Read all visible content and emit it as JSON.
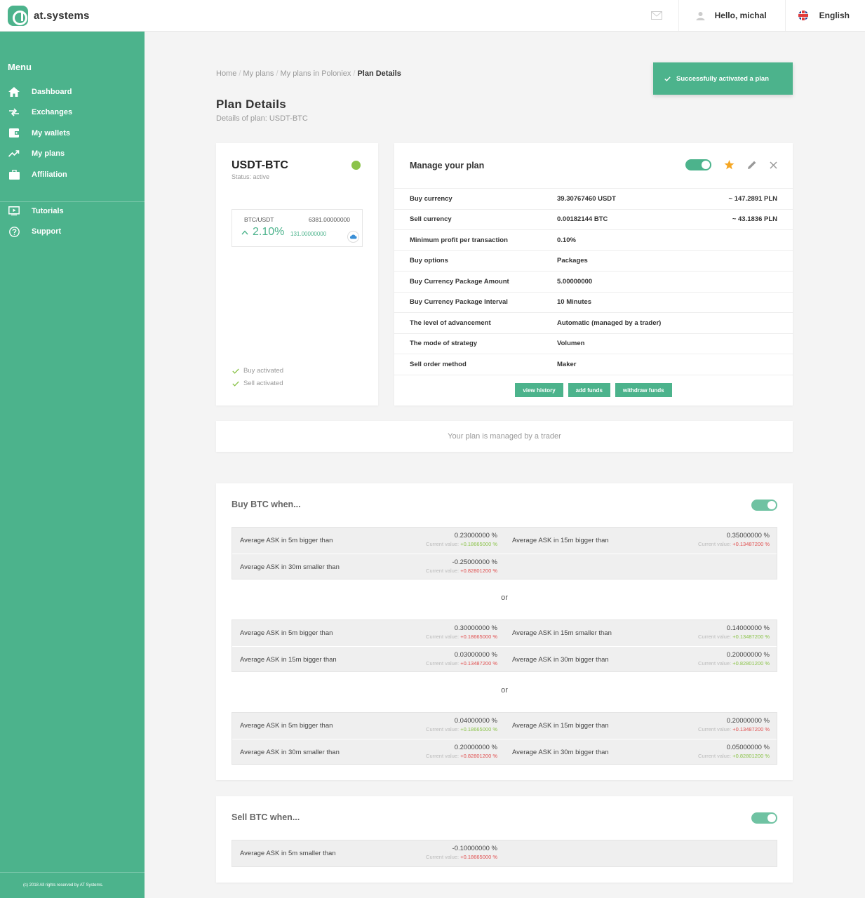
{
  "header": {
    "brand": "at.systems",
    "greeting": "Hello, michal",
    "language": "English"
  },
  "sidebar": {
    "menu_title": "Menu",
    "items": [
      {
        "label": "Dashboard",
        "icon": "home-icon"
      },
      {
        "label": "Exchanges",
        "icon": "exchange-icon"
      },
      {
        "label": "My wallets",
        "icon": "wallet-icon"
      },
      {
        "label": "My plans",
        "icon": "trend-icon"
      },
      {
        "label": "Affiliation",
        "icon": "briefcase-icon"
      }
    ],
    "items2": [
      {
        "label": "Tutorials",
        "icon": "play-icon"
      },
      {
        "label": "Support",
        "icon": "help-icon"
      }
    ],
    "footer": "(c) 2018 All rights reserved by AT Systems."
  },
  "breadcrumb": {
    "items": [
      "Home",
      "My plans",
      "My plans in Poloniex"
    ],
    "current": "Plan Details"
  },
  "page": {
    "title": "Plan Details",
    "subtitle": "Details of plan: USDT-BTC"
  },
  "toast": {
    "message": "Successfully activated a plan"
  },
  "pair": {
    "name": "USDT-BTC",
    "status": "Status: active",
    "status_color": "#8bc34a",
    "ticker_name": "BTC/USDT",
    "ticker_price": "6381.00000000",
    "change": "2.10%",
    "volume": "131.00000000",
    "buy_activated": "Buy activated",
    "sell_activated": "Sell activated"
  },
  "manage": {
    "title": "Manage your plan",
    "rows": [
      {
        "key": "Buy currency",
        "value": "39.30767460 USDT",
        "pln": "~ 147.2891 PLN"
      },
      {
        "key": "Sell currency",
        "value": "0.00182144 BTC",
        "pln": "~ 43.1836 PLN"
      },
      {
        "key": "Minimum profit per transaction",
        "value": "0.10%",
        "pln": ""
      },
      {
        "key": "Buy options",
        "value": "Packages",
        "pln": ""
      },
      {
        "key": "Buy Currency Package Amount",
        "value": "5.00000000",
        "pln": ""
      },
      {
        "key": "Buy Currency Package Interval",
        "value": "10 Minutes",
        "pln": ""
      },
      {
        "key": "The level of advancement",
        "value": "Automatic (managed by a trader)",
        "pln": ""
      },
      {
        "key": "The mode of strategy",
        "value": "Volumen",
        "pln": ""
      },
      {
        "key": "Sell order method",
        "value": "Maker",
        "pln": ""
      }
    ],
    "buttons": {
      "history": "view history",
      "add": "add funds",
      "withdraw": "withdraw funds"
    }
  },
  "trader_notice": "Your plan is managed by a trader",
  "or_label": "or",
  "buy": {
    "title": "Buy BTC when...",
    "groups": [
      [
        [
          {
            "label": "Average ASK in 5m bigger than",
            "value": "0.23000000 %",
            "cur_prefix": "Current value: ",
            "cur": "+0.18665000 %",
            "tone": "pos"
          },
          {
            "label": "Average ASK in 15m bigger than",
            "value": "0.35000000 %",
            "cur_prefix": "Current value: ",
            "cur": "+0.13487200 %",
            "tone": "neg"
          }
        ],
        [
          {
            "label": "Average ASK in 30m smaller than",
            "value": "-0.25000000 %",
            "cur_prefix": "Current value: ",
            "cur": "+0.82801200 %",
            "tone": "neg"
          }
        ]
      ],
      [
        [
          {
            "label": "Average ASK in 5m bigger than",
            "value": "0.30000000 %",
            "cur_prefix": "Current value: ",
            "cur": "+0.18665000 %",
            "tone": "neg"
          },
          {
            "label": "Average ASK in 15m smaller than",
            "value": "0.14000000 %",
            "cur_prefix": "Current value: ",
            "cur": "+0.13487200 %",
            "tone": "pos"
          }
        ],
        [
          {
            "label": "Average ASK in 15m bigger than",
            "value": "0.03000000 %",
            "cur_prefix": "Current value: ",
            "cur": "+0.13487200 %",
            "tone": "neg"
          },
          {
            "label": "Average ASK in 30m bigger than",
            "value": "0.20000000 %",
            "cur_prefix": "Current value: ",
            "cur": "+0.82801200 %",
            "tone": "pos"
          }
        ]
      ],
      [
        [
          {
            "label": "Average ASK in 5m bigger than",
            "value": "0.04000000 %",
            "cur_prefix": "Current value: ",
            "cur": "+0.18665000 %",
            "tone": "pos"
          },
          {
            "label": "Average ASK in 15m bigger than",
            "value": "0.20000000 %",
            "cur_prefix": "Current value: ",
            "cur": "+0.13487200 %",
            "tone": "neg"
          }
        ],
        [
          {
            "label": "Average ASK in 30m smaller than",
            "value": "0.20000000 %",
            "cur_prefix": "Current value: ",
            "cur": "+0.82801200 %",
            "tone": "neg"
          },
          {
            "label": "Average ASK in 30m bigger than",
            "value": "0.05000000 %",
            "cur_prefix": "Current value: ",
            "cur": "+0.82801200 %",
            "tone": "pos"
          }
        ]
      ]
    ]
  },
  "sell": {
    "title": "Sell BTC when...",
    "groups": [
      [
        [
          {
            "label": "Average ASK in 5m smaller than",
            "value": "-0.10000000 %",
            "cur_prefix": "Current value: ",
            "cur": "+0.18665000 %",
            "tone": "neg"
          }
        ]
      ]
    ]
  },
  "colors": {
    "accent": "#4cb38c",
    "active": "#8bc34a",
    "negative": "#e05050",
    "star": "#f5a623"
  }
}
